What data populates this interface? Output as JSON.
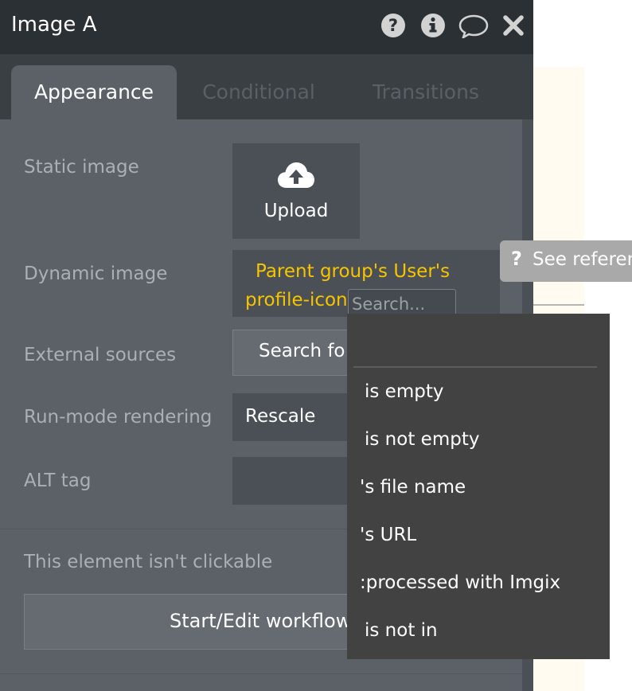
{
  "window": {
    "title": "Image A",
    "icons": [
      "question-circle-icon",
      "info-circle-icon",
      "comment-icon",
      "close-icon"
    ]
  },
  "tabs": [
    {
      "label": "Appearance",
      "active": true
    },
    {
      "label": "Conditional",
      "active": false
    },
    {
      "label": "Transitions",
      "active": false
    }
  ],
  "fields": {
    "static_image": {
      "label": "Static image",
      "button": "Upload",
      "icon": "cloud-upload-icon"
    },
    "dynamic_image": {
      "label": "Dynamic image",
      "expression_line1": "Parent group's User's",
      "expression_line2": "profile-icon",
      "search_placeholder": "Search..."
    },
    "external_sources": {
      "label": "External sources",
      "button": "Search fo"
    },
    "run_mode": {
      "label": "Run-mode rendering",
      "value": "Rescale"
    },
    "alt_tag": {
      "label": "ALT tag",
      "value": ""
    }
  },
  "clickable_note": "This element isn't clickable",
  "workflow_button": "Start/Edit workflow",
  "reference": {
    "icon": "question-icon",
    "q": "?",
    "label": "See referen"
  },
  "dropdown": {
    "items": [
      {
        "label": "is empty"
      },
      {
        "label": "is not empty"
      },
      {
        "label": "'s file name"
      },
      {
        "label": "'s URL"
      },
      {
        "label": ":processed with Imgix"
      },
      {
        "label": "is not in"
      }
    ]
  },
  "colors": {
    "panel": "#5b6166",
    "titlebar": "#2b3034",
    "tabs_bg": "#3a3f44",
    "expression": "#f7c400",
    "dropdown_bg": "#424242"
  }
}
